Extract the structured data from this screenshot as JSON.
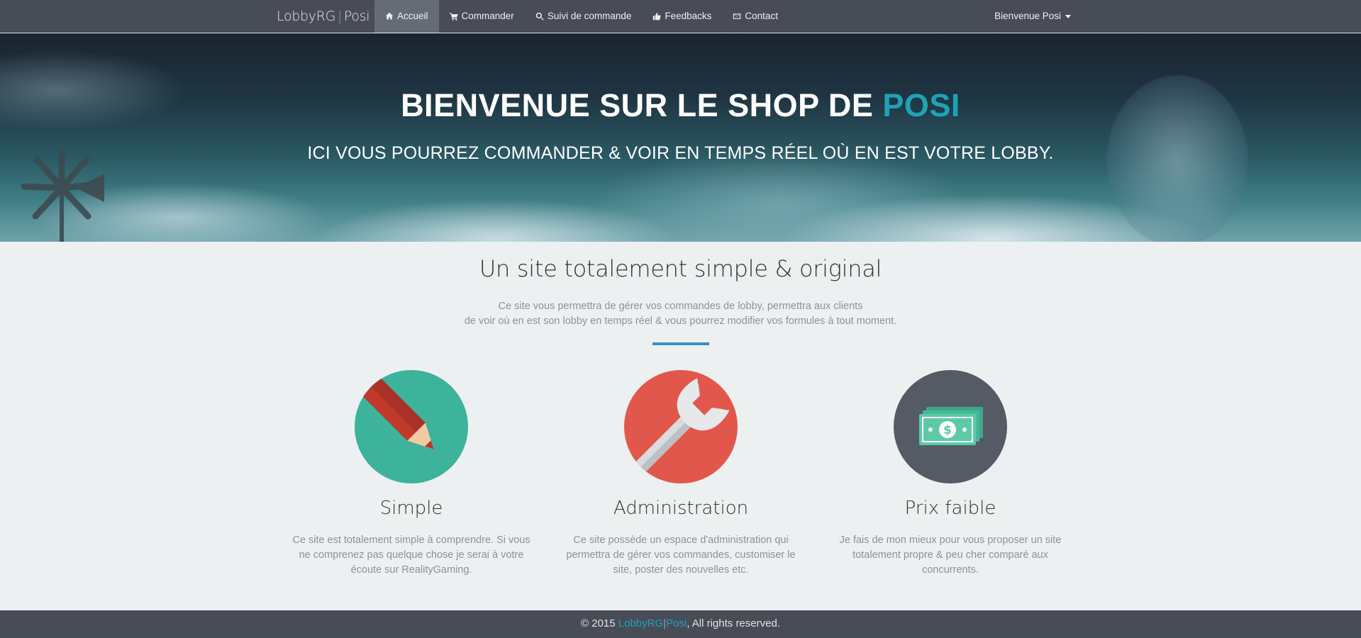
{
  "nav": {
    "brand_left": "LobbyRG",
    "brand_sep": "|",
    "brand_right": "Posi",
    "items": [
      {
        "label": "Accueil",
        "icon": "home-icon",
        "active": true
      },
      {
        "label": "Commander",
        "icon": "cart-icon",
        "active": false
      },
      {
        "label": "Suivi de commande",
        "icon": "search-icon",
        "active": false
      },
      {
        "label": "Feedbacks",
        "icon": "thumbs-up-icon",
        "active": false
      },
      {
        "label": "Contact",
        "icon": "envelope-icon",
        "active": false
      }
    ],
    "user_label": "Bienvenue Posi"
  },
  "hero": {
    "title_main": "BIENVENUE SUR LE SHOP DE ",
    "title_accent": "POSI",
    "subtitle": "ICI VOUS POURREZ COMMANDER & VOIR EN TEMPS RÉEL OÙ EN EST VOTRE LOBBY."
  },
  "intro": {
    "title": "Un site totalement simple & original",
    "desc_line1": "Ce site vous permettra de gérer vos commandes de lobby, permettra aux clients",
    "desc_line2": "de voir où en est son lobby en temps réel & vous pourrez modifier vos formules à tout moment."
  },
  "features": [
    {
      "title": "Simple",
      "text": "Ce site est totalement simple à comprendre. Si vous ne comprenez pas quelque chose je serai à votre écoute sur RealityGaming.",
      "icon": "pencil-icon",
      "color": "#3cb39a"
    },
    {
      "title": "Administration",
      "text": "Ce site possède un espace d'administration qui permettra de gérer vos commandes, customiser le site, poster des nouvelles etc.",
      "icon": "wrench-icon",
      "color": "#e2574c"
    },
    {
      "title": "Prix faible",
      "text": "Je fais de mon mieux pour vous proposer un site totalement propre & peu cher comparé aux concurrents.",
      "icon": "money-icon",
      "color": "#545b65"
    }
  ],
  "footer": {
    "prefix": "© 2015 ",
    "brand_left": "LobbyRG",
    "brand_sep": "|",
    "brand_right": "Posi",
    "suffix": ", All rights reserved."
  },
  "colors": {
    "navbar": "#474c56",
    "accent": "#1fa2b5",
    "divider": "#3291c9",
    "background": "#edf0f1"
  }
}
